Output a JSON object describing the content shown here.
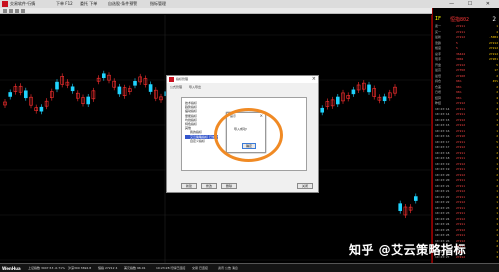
{
  "window": {
    "titles": [
      "交易软件·行情",
      "下单 F12",
      "委托 下单",
      "自选股·条件预警",
      "指标管理"
    ],
    "controls": "— ☐ ✕"
  },
  "quote_panel": {
    "code": "IF",
    "name": "恒指802",
    "last": "27212",
    "change": "4",
    "change2": "2",
    "rows": [
      {
        "label": "卖一",
        "value": "27211",
        "extra": "1"
      },
      {
        "label": "买一",
        "value": "27211",
        "extra": "4"
      },
      {
        "label": "最新",
        "value": "27212",
        "extra": "-5004"
      },
      {
        "label": "涨跌",
        "value": "5",
        "extra": "27212"
      },
      {
        "label": "幅度",
        "value": "5",
        "extra": "27212"
      },
      {
        "label": "总手",
        "value": "36444",
        "extra": "27212"
      },
      {
        "label": "现手",
        "value": "3004",
        "extra": "27201"
      },
      {
        "label": "开盘",
        "value": "27212",
        "extra": "5"
      },
      {
        "label": "最高",
        "value": "27350",
        "extra": "17"
      },
      {
        "label": "最低",
        "value": "27160",
        "extra": "2"
      },
      {
        "label": "持仓",
        "value": "96%",
        "extra": "45%"
      },
      {
        "label": "仓差",
        "value": "96%",
        "extra": "2"
      },
      {
        "label": "日增",
        "value": "96%",
        "extra": "2"
      },
      {
        "label": "结算",
        "value": "96%",
        "extra": "4"
      },
      {
        "label": "昨结",
        "value": "27212",
        "extra": "1"
      },
      {
        "label": "10:23:14",
        "value": "27211",
        "extra": "4"
      },
      {
        "label": "10:23:14",
        "value": "27211",
        "extra": "2"
      },
      {
        "label": "10:23:15",
        "value": "27212",
        "extra": "1"
      },
      {
        "label": "10:23:15",
        "value": "27212",
        "extra": "3"
      },
      {
        "label": "10:23:16",
        "value": "27211",
        "extra": "1"
      },
      {
        "label": "10:23:16",
        "value": "27210",
        "extra": "2"
      },
      {
        "label": "10:23:17",
        "value": "27211",
        "extra": "5"
      },
      {
        "label": "10:23:17",
        "value": "27212",
        "extra": "1"
      },
      {
        "label": "10:23:18",
        "value": "27211",
        "extra": "2"
      },
      {
        "label": "10:23:18",
        "value": "27211",
        "extra": "4"
      },
      {
        "label": "10:23:19",
        "value": "27212",
        "extra": "1"
      },
      {
        "label": "10:23:19",
        "value": "27211",
        "extra": "3"
      },
      {
        "label": "10:23:20",
        "value": "27212",
        "extra": "2"
      },
      {
        "label": "10:23:20",
        "value": "27211",
        "extra": "1"
      },
      {
        "label": "10:23:21",
        "value": "27211",
        "extra": "2"
      },
      {
        "label": "10:23:21",
        "value": "27212",
        "extra": "1"
      },
      {
        "label": "10:23:22",
        "value": "27211",
        "extra": "4"
      },
      {
        "label": "10:23:22",
        "value": "27212",
        "extra": "1"
      },
      {
        "label": "10:23:23",
        "value": "27211",
        "extra": "2"
      },
      {
        "label": "10:23:23",
        "value": "27211",
        "extra": "1"
      },
      {
        "label": "10:23:24",
        "value": "27212",
        "extra": "3"
      },
      {
        "label": "10:23:24",
        "value": "27211",
        "extra": "1"
      },
      {
        "label": "10:23:25",
        "value": "27212",
        "extra": "2"
      },
      {
        "label": "10:23:25",
        "value": "27211",
        "extra": "1"
      },
      {
        "label": "10:23:26",
        "value": "27212",
        "extra": "4"
      },
      {
        "label": "10:23:26",
        "value": "27211",
        "extra": "2"
      },
      {
        "label": "10:23:27",
        "value": "27211",
        "extra": "1"
      },
      {
        "label": "10:23:27",
        "value": "27212",
        "extra": "3"
      }
    ]
  },
  "dialog": {
    "title": "指标管理",
    "tabs": [
      "公式管理",
      "导入导出"
    ],
    "tree": [
      "技术指标",
      "趋势指标",
      "摆动指标",
      "量能指标",
      "均线指标",
      "特色指标",
      "其他",
      "我的指标",
      "艾云策略指标 已加密",
      "自定义指标"
    ],
    "selected_index": 8,
    "buttons": [
      "新建",
      "修改",
      "删除",
      "关闭"
    ]
  },
  "message_box": {
    "title": "提示",
    "text": "导入成功!",
    "button": "确定"
  },
  "status": {
    "logo": "WenHua",
    "segments": [
      "上证指数 3047.53 -0.71%",
      "沪深300 3692.8",
      "恒指 27212 4",
      "美元指数 96.01",
      "10:23:28 行情已连接",
      "交易 已连接",
      "资讯 公告 消息"
    ]
  },
  "watermark": "知乎 @艾云策略指标",
  "colors": {
    "up": "#ff3030",
    "down": "#20d4ff",
    "accent": "#f08a24"
  }
}
